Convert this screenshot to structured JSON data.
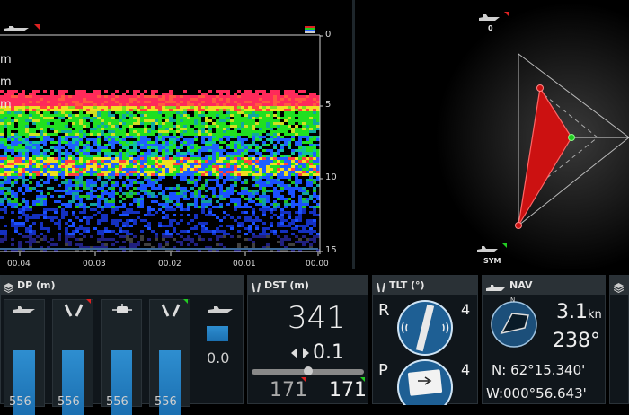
{
  "echogram": {
    "unit_rows": [
      "m",
      "m",
      "m"
    ],
    "depth_ticks": [
      "0",
      "5",
      "10",
      "15"
    ],
    "time_ticks": [
      "00.04",
      "00.03",
      "00.02",
      "00.01",
      "00.00"
    ]
  },
  "radar": {
    "top_label": "0",
    "bottom_label": "SYM"
  },
  "dp": {
    "title": "DP (m)",
    "bar_levels": [
      0.72,
      0.72,
      0.72,
      0.72,
      0.28
    ],
    "bottom_values": [
      "556",
      "556",
      "556",
      "556"
    ],
    "thruster_value": "0.0"
  },
  "dst": {
    "title": "DST (m)",
    "value": "341",
    "delta": "0.1",
    "left_value": "171",
    "right_value": "171"
  },
  "tlt": {
    "title": "TLT (°)",
    "r_label": "R",
    "r_value": "4",
    "p_label": "P",
    "p_value": "4"
  },
  "nav": {
    "title": "NAV",
    "north": "N",
    "speed": "3.1",
    "speed_unit": "kn",
    "heading": "238°",
    "lat_label": "N:",
    "lat_value": "62°15.340'",
    "lon_label": "W:",
    "lon_value": "000°56.643'"
  },
  "colors": {
    "accent_red": "#dd2222",
    "accent_green": "#22cc22",
    "bar_blue": "#2e8ed0",
    "panel_bg": "#10161b",
    "header_bg": "#2a3136"
  }
}
